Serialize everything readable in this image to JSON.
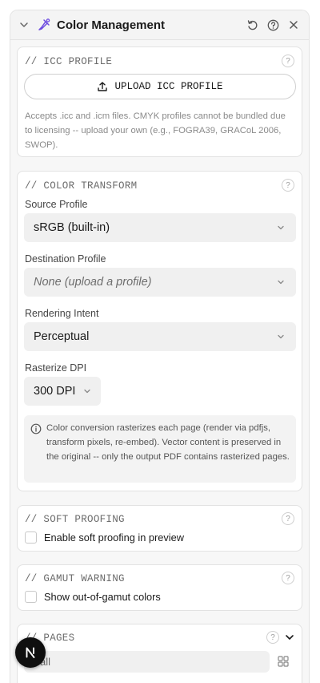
{
  "panel": {
    "title": "Color Management",
    "icons": {
      "collapse": "chevron-down-icon",
      "brand": "palette-brush-icon",
      "reset": "reset-icon",
      "help": "help-icon",
      "close": "close-icon"
    }
  },
  "icc_profile": {
    "title": "// ICC PROFILE",
    "upload_label": "UPLOAD ICC PROFILE",
    "hint": "Accepts .icc and .icm files. CMYK profiles cannot be bundled due to licensing -- upload your own (e.g., FOGRA39, GRACoL 2006, SWOP)."
  },
  "color_transform": {
    "title": "// COLOR TRANSFORM",
    "source_label": "Source Profile",
    "source_value": "sRGB (built-in)",
    "destination_label": "Destination Profile",
    "destination_placeholder": "None (upload a profile)",
    "intent_label": "Rendering Intent",
    "intent_value": "Perceptual",
    "dpi_label": "Rasterize DPI",
    "dpi_value": "300 DPI",
    "info": "Color conversion rasterizes each page (render via pdfjs, transform pixels, re-embed). Vector content is preserved in the original -- only the output PDF contains rasterized pages."
  },
  "soft_proofing": {
    "title": "// SOFT PROOFING",
    "checkbox_label": "Enable soft proofing in preview",
    "checked": false
  },
  "gamut_warning": {
    "title": "// GAMUT WARNING",
    "checkbox_label": "Show out-of-gamut colors",
    "checked": false
  },
  "pages": {
    "title": "// PAGES",
    "value": "all"
  },
  "colors": {
    "accent": "#6d4ce0",
    "fab": "#0f0f0f"
  }
}
